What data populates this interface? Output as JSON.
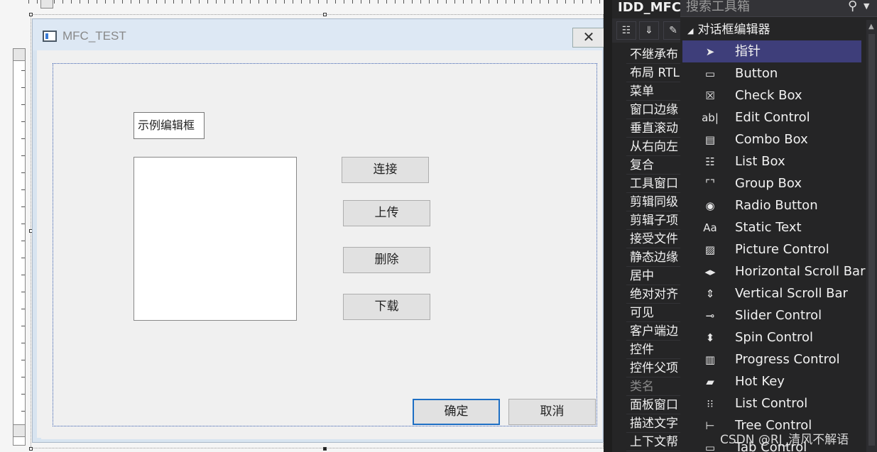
{
  "dialog": {
    "title": "MFC_TEST",
    "close_glyph": "✕",
    "static_text": "示例编辑框",
    "buttons": {
      "connect": "连接",
      "upload": "上传",
      "delete": "删除",
      "download": "下载",
      "ok": "确定",
      "cancel": "取消"
    }
  },
  "properties": {
    "title": "IDD_MFC",
    "items": [
      "不继承布",
      "布局 RTL",
      "菜单",
      "窗口边缘",
      "垂直滚动",
      "从右向左",
      "复合",
      "工具窗口",
      "剪辑同级",
      "剪辑子项",
      "接受文件",
      "静态边缘",
      "居中",
      "绝对对齐",
      "可见",
      "客户端边",
      "控件",
      "控件父项",
      "类名",
      "面板窗口",
      "描述文字",
      "上下文帮"
    ]
  },
  "toolbox": {
    "search_placeholder": "搜索工具箱",
    "group": "对话框编辑器",
    "items": [
      {
        "label": "指针",
        "icon": "pointer-icon",
        "glyph": "➤"
      },
      {
        "label": "Button",
        "icon": "button-icon",
        "glyph": "▭"
      },
      {
        "label": "Check Box",
        "icon": "checkbox-icon",
        "glyph": "☒"
      },
      {
        "label": "Edit Control",
        "icon": "edit-control-icon",
        "glyph": "ab|"
      },
      {
        "label": "Combo Box",
        "icon": "combo-box-icon",
        "glyph": "▤"
      },
      {
        "label": "List Box",
        "icon": "list-box-icon",
        "glyph": "☷"
      },
      {
        "label": "Group Box",
        "icon": "group-box-icon",
        "glyph": "⌜⌝"
      },
      {
        "label": "Radio Button",
        "icon": "radio-button-icon",
        "glyph": "◉"
      },
      {
        "label": "Static Text",
        "icon": "static-text-icon",
        "glyph": "Aa"
      },
      {
        "label": "Picture Control",
        "icon": "picture-control-icon",
        "glyph": "▨"
      },
      {
        "label": "Horizontal Scroll Bar",
        "icon": "hscroll-icon",
        "glyph": "◂▸"
      },
      {
        "label": "Vertical Scroll Bar",
        "icon": "vscroll-icon",
        "glyph": "⇕"
      },
      {
        "label": "Slider Control",
        "icon": "slider-icon",
        "glyph": "⊸"
      },
      {
        "label": "Spin Control",
        "icon": "spin-icon",
        "glyph": "⬍"
      },
      {
        "label": "Progress Control",
        "icon": "progress-icon",
        "glyph": "▥"
      },
      {
        "label": "Hot Key",
        "icon": "hot-key-icon",
        "glyph": "▰"
      },
      {
        "label": "List Control",
        "icon": "list-control-icon",
        "glyph": "⁝⁝"
      },
      {
        "label": "Tree Control",
        "icon": "tree-control-icon",
        "glyph": "⊢"
      },
      {
        "label": "Tab Control",
        "icon": "tab-control-icon",
        "glyph": "▭"
      }
    ]
  },
  "watermark": "CSDN @RJ_清风不解语"
}
